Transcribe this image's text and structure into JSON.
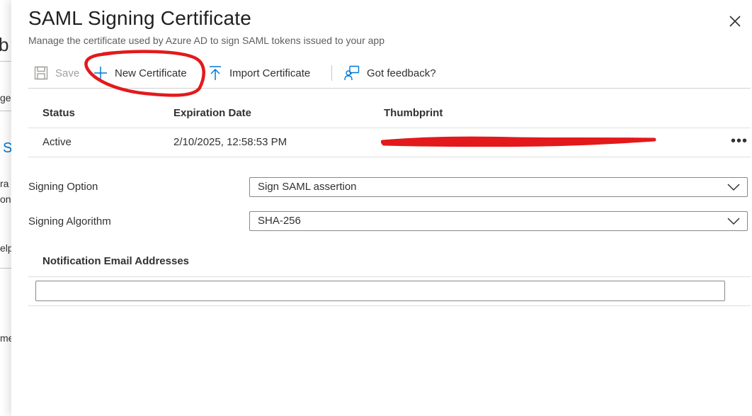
{
  "background": {
    "fragments": [
      "b",
      "ge",
      "S",
      "ra",
      "on",
      "elp",
      "me"
    ]
  },
  "panel": {
    "title": "SAML Signing Certificate",
    "subtitle": "Manage the certificate used by Azure AD to sign SAML tokens issued to your app"
  },
  "toolbar": {
    "save_label": "Save",
    "new_certificate_label": "New Certificate",
    "import_certificate_label": "Import Certificate",
    "feedback_label": "Got feedback?"
  },
  "certificates": {
    "columns": [
      "Status",
      "Expiration Date",
      "Thumbprint"
    ],
    "rows": [
      {
        "status": "Active",
        "expiration": "2/10/2025, 12:58:53 PM",
        "more": "•••"
      }
    ]
  },
  "signing_option": {
    "label": "Signing Option",
    "value": "Sign SAML assertion"
  },
  "signing_algorithm": {
    "label": "Signing Algorithm",
    "value": "SHA-256"
  },
  "notification": {
    "label": "Notification Email Addresses",
    "value": ""
  },
  "colors": {
    "accent": "#0078d4",
    "annotation": "#e3191c",
    "redaction": "#e3191c"
  },
  "icons": [
    "save-icon",
    "plus-icon",
    "upload-icon",
    "feedback-icon",
    "close-icon",
    "chevron-down-icon",
    "more-icon"
  ]
}
